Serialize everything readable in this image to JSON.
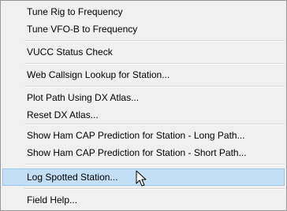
{
  "menu": {
    "items": [
      {
        "label": "Tune Rig to Frequency"
      },
      {
        "label": "Tune VFO-B to Frequency"
      },
      {
        "label": "VUCC Status Check"
      },
      {
        "label": "Web Callsign Lookup for Station..."
      },
      {
        "label": "Plot Path Using DX Atlas..."
      },
      {
        "label": "Reset DX Atlas..."
      },
      {
        "label": "Show Ham CAP Prediction for Station - Long Path..."
      },
      {
        "label": "Show Ham CAP Prediction for Station - Short Path..."
      },
      {
        "label": "Log Spotted Station...",
        "highlighted": true
      },
      {
        "label": "Field Help..."
      }
    ],
    "highlight_color": "#c3dff7",
    "highlight_border_color": "#9cc6ee"
  },
  "cursor": {
    "icon": "mouse-pointer-icon"
  }
}
